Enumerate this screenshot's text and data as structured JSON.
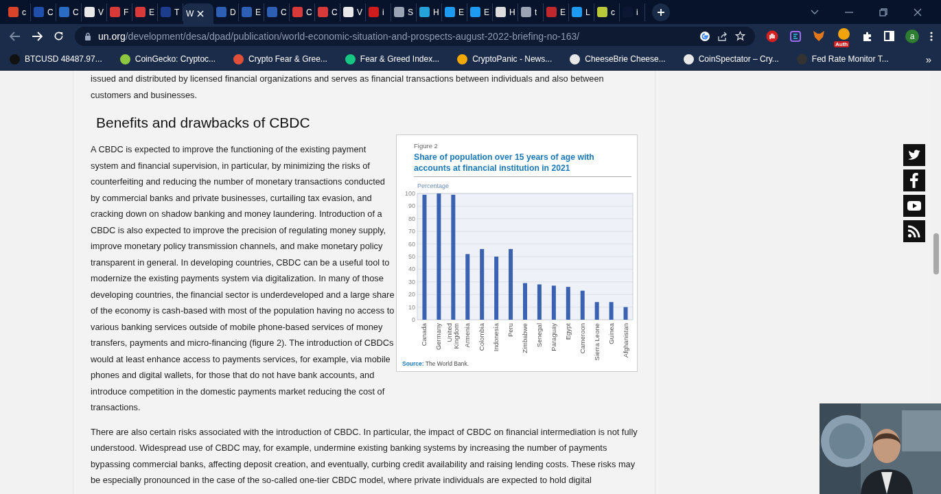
{
  "tabs": [
    {
      "title": "c",
      "color": "#d9442b",
      "selected": false
    },
    {
      "title": "C",
      "color": "#1f4fa8",
      "selected": false
    },
    {
      "title": "C",
      "color": "#2a6cc4",
      "selected": false
    },
    {
      "title": "V",
      "color": "#e8e8e8",
      "selected": false
    },
    {
      "title": "F",
      "color": "#d83a3a",
      "selected": false
    },
    {
      "title": "E",
      "color": "#d83a3a",
      "selected": false
    },
    {
      "title": "T",
      "color": "#1c3c8c",
      "selected": false
    },
    {
      "title": "W",
      "selected": true
    },
    {
      "title": "D",
      "color": "#2d5fb5",
      "selected": false
    },
    {
      "title": "E",
      "color": "#2d5fb5",
      "selected": false
    },
    {
      "title": "C",
      "color": "#2d5fb5",
      "selected": false
    },
    {
      "title": "C",
      "color": "#d83a3a",
      "selected": false
    },
    {
      "title": "C",
      "color": "#d83a3a",
      "selected": false
    },
    {
      "title": "V",
      "color": "#e8e8e8",
      "selected": false
    },
    {
      "title": "i",
      "color": "#d01c1c",
      "selected": false
    },
    {
      "title": "S",
      "color": "#9aa4b4",
      "selected": false
    },
    {
      "title": "H",
      "color": "#25a3d9",
      "selected": false
    },
    {
      "title": "E",
      "color": "#1d9bf0",
      "selected": false
    },
    {
      "title": "E",
      "color": "#1d9bf0",
      "selected": false
    },
    {
      "title": "H",
      "color": "#dddddd",
      "selected": false
    },
    {
      "title": "t",
      "color": "#9aa4b4",
      "selected": false
    },
    {
      "title": "E",
      "color": "#c0282d",
      "selected": false
    },
    {
      "title": "L",
      "color": "#1d9bf0",
      "selected": false
    },
    {
      "title": "c",
      "color": "#b9c93a",
      "selected": false
    },
    {
      "title": "i",
      "color": "#0b1733",
      "selected": false
    }
  ],
  "address": {
    "domain": "un.org",
    "path": "/development/desa/dpad/publication/world-economic-situation-and-prospects-august-2022-briefing-no-163/"
  },
  "extensions": {
    "auth_badge": "Auth",
    "profile": "a"
  },
  "bookmarks": [
    {
      "label": "BTCUSD 48487.97...",
      "color": "#111111"
    },
    {
      "label": "CoinGecko: Cryptoc...",
      "color": "#8dc63f"
    },
    {
      "label": "Crypto Fear & Gree...",
      "color": "#e0503a"
    },
    {
      "label": "Fear & Greed Index...",
      "color": "#16c784"
    },
    {
      "label": "CryptoPanic - News...",
      "color": "#f2a900"
    },
    {
      "label": "CheeseBrie Cheese...",
      "color": "#e8e8e8"
    },
    {
      "label": "CoinSpectator – Cry...",
      "color": "#e8e8e8"
    },
    {
      "label": "Fed Rate Monitor T...",
      "color": "#333333"
    }
  ],
  "bookmarks_more": "»",
  "article": {
    "intro": "issued and distributed by licensed financial organizations and serves as financial transactions between individuals and also between customers and businesses.",
    "heading": "Benefits and drawbacks of CBDC",
    "paragraphs": [
      "A CBDC is expected to improve the functioning of the existing payment system and financial supervision, in particular, by minimizing the risks of counterfeiting and reducing the number of monetary transactions conducted by commercial banks and private businesses, curtailing tax evasion, and cracking down on shadow banking and money laundering. Introduction of a CBDC is also expected to improve the precision of regulating money supply, improve monetary policy transmission channels, and make monetary policy transparent in general. In developing countries, CBDC can be a useful tool to modernize the existing payments system via digitalization. In many of those developing countries, the financial sector is underdeveloped and a large share of the economy is cash-based with most of the population having no access to various banking services outside of mobile phone-based services of money transfers, payments and micro-financing (figure 2). The introduction of CBDCs would at least enhance access to payments services, for example, via mobile phones and digital wallets, for those that do not have bank accounts, and introduce competition in the domestic payments market reducing the cost of transactions.",
      "There are also certain risks associated with the introduction of CBDC. In particular, the impact of CBDC on financial intermediation is not fully understood. Widespread use of CBDC may, for example, undermine existing banking systems by increasing the number of payments bypassing commercial banks, affecting deposit creation, and eventually, curbing credit availability and raising lending costs. These risks may be especially pronounced in the case of the so-called one-tier CBDC model, where private individuals are expected to hold digital"
    ],
    "figure": {
      "label": "Figure 2",
      "source_label": "Source:",
      "source": "The World Bank.",
      "chart_data": {
        "type": "bar",
        "title": "Share of population over 15 years of age with accounts at financial institution in 2021",
        "ylabel": "Percentage",
        "categories": [
          "Canada",
          "Germany",
          "United Kingdom",
          "Armenia",
          "Colombia",
          "Indonesia",
          "Peru",
          "Zimbabwe",
          "Senegal",
          "Paraguay",
          "Egypt",
          "Cameroon",
          "Sierra Leone",
          "Guinea",
          "Afghanistan"
        ],
        "grid": true,
        "series": [
          {
            "color": "#3a62b0",
            "values": [
              99,
              100,
              99,
              52,
              56,
              50,
              56,
              29,
              28,
              27,
              26,
              23,
              14,
              14,
              10
            ]
          }
        ],
        "ylim": [
          0,
          100
        ],
        "yticks": [
          0,
          10,
          20,
          30,
          40,
          50,
          60,
          70,
          80,
          90,
          100
        ]
      }
    }
  }
}
